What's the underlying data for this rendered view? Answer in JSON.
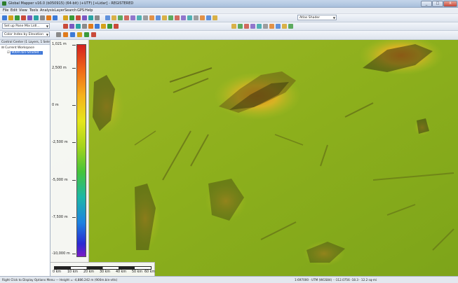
{
  "window": {
    "title": "Global Mapper v16.0 (b050915) (64-bit) (+UTF) [+Lidar] - REGISTERED",
    "min_label": "_",
    "max_label": "□",
    "close_label": "X"
  },
  "menu": [
    "File",
    "Edit",
    "View",
    "Tools",
    "Analysis",
    "Layer",
    "Search",
    "GPS",
    "Help"
  ],
  "toolbar": {
    "rows_icons": [
      [
        "open-icon",
        "save-icon",
        "tools-icon",
        "digitizer-icon",
        "measure-icon",
        "zoom-in-icon",
        "zoom-out-icon",
        "pan-icon",
        "home-icon",
        "select-icon",
        "info-icon",
        "globe-icon",
        "view-3d-icon",
        "layer-icon",
        "script-icon"
      ],
      [
        "draw-icon",
        "line-icon",
        "feature-icon",
        "shape-icon",
        "point-icon",
        "edit-icon",
        "gps-icon",
        "vertex-icon",
        "path-icon"
      ],
      [
        "gear-icon",
        "legend-icon",
        "elevation-icon",
        "shader-icon",
        "grid-icon",
        "contour-icon"
      ]
    ],
    "shader_combo": "Atlas Shader",
    "task_combo": "Set up Pane Mix Lidl...",
    "elevation_combo": "Color Index by Elevation"
  },
  "control_center": {
    "header": "Control Center (1 Layers, 1 Selec...",
    "workspace_label": "Current Workspace",
    "layer_label": "900m.bin-Shaded...",
    "layer_checked": true
  },
  "legend": {
    "labels": [
      "1,021 m",
      "2,500 m",
      "0 m",
      "-2,500 m",
      "-5,000 m",
      "-7,500 m",
      "-10,000 m"
    ],
    "ramp_colors": [
      "#d42020",
      "#f06a18",
      "#f5b21c",
      "#e6e61c",
      "#a6d41c",
      "#46c43a",
      "#1cb7a6",
      "#1c82e0",
      "#2a2ad2",
      "#7a1cc4"
    ]
  },
  "scale": {
    "labels": [
      "0 km",
      "10 km",
      "20 km",
      "30 km",
      "40 km",
      "50 km",
      "60 km"
    ]
  },
  "status": {
    "left": "Right Click to Display Options Menu  ---  Height = -4,886.242 m (900m.bin-vtts)",
    "right": "1:697000 · UTM (WGS84) · -112.0756 -18.3 · 12.2 sq-mi"
  }
}
